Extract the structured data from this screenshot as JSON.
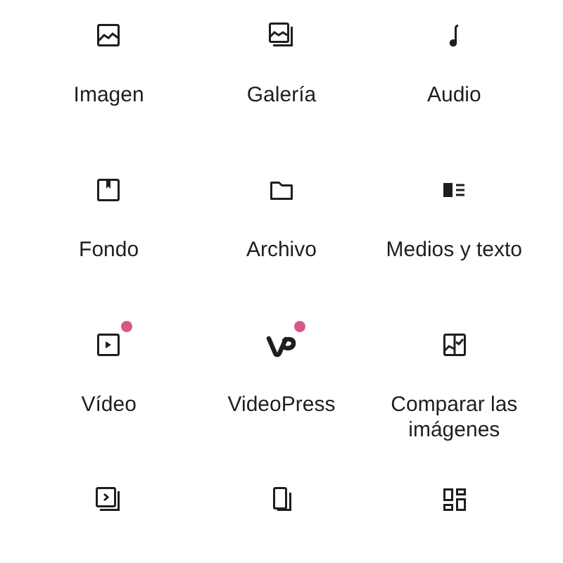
{
  "blocks": [
    {
      "label": "Imagen",
      "badge": false
    },
    {
      "label": "Galería",
      "badge": false
    },
    {
      "label": "Audio",
      "badge": false
    },
    {
      "label": "Fondo",
      "badge": false
    },
    {
      "label": "Archivo",
      "badge": false
    },
    {
      "label": "Medios y texto",
      "badge": false
    },
    {
      "label": "Vídeo",
      "badge": true
    },
    {
      "label": "VideoPress",
      "badge": true
    },
    {
      "label": "Comparar las imágenes",
      "badge": false
    },
    {
      "badge": false
    },
    {
      "badge": false
    },
    {
      "badge": false
    }
  ]
}
